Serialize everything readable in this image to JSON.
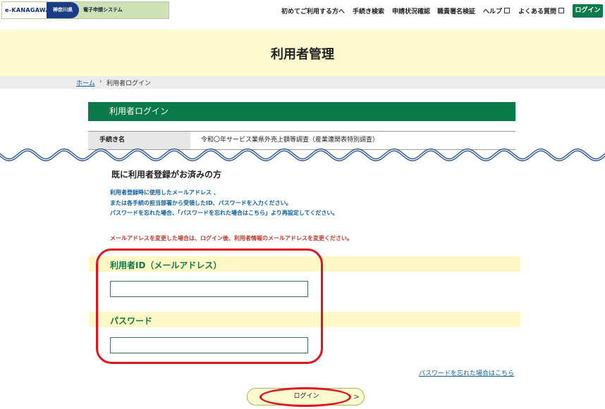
{
  "header": {
    "logo": {
      "brand": "e-KANAGAWA",
      "prefecture": "神奈川県",
      "system": "電子申請システム"
    },
    "nav": [
      {
        "label": "初めてご利用する方へ",
        "external": false
      },
      {
        "label": "手続き検索",
        "external": false
      },
      {
        "label": "申請状況確認",
        "external": false
      },
      {
        "label": "職責署名検証",
        "external": false
      },
      {
        "label": "ヘルプ",
        "external": true
      },
      {
        "label": "よくある質問",
        "external": true
      }
    ],
    "login_label": "ログイン"
  },
  "page_title": "利用者管理",
  "breadcrumb": {
    "home": "ホーム",
    "separator": "›",
    "current": "利用者ログイン"
  },
  "section_heading": "利用者ログイン",
  "procedure": {
    "label": "手続き名",
    "value": "令和〇年サービス業県外売上額等調査（産業連関表特別調査）"
  },
  "login_section": {
    "heading": "既に利用者登録がお済みの方",
    "info_lines": [
      "利用者登録時に使用したメールアドレス 、",
      "または各手続の担当部署から受領したID、パスワードを入力ください。",
      "パスワードを忘れた場合、「パスワードを忘れた場合はこちら」より再設定してください。"
    ],
    "warning": "メールアドレスを変更した場合は、ログイン後、利用者情報のメールアドレスを変更ください。",
    "user_id_label": "利用者ID（メールアドレス）",
    "user_id_value": "",
    "password_label": "パスワード",
    "password_value": "",
    "forgot_link": "パスワードを忘れた場合はこちら",
    "login_button": "ログイン",
    "login_arrow": ">"
  },
  "colors": {
    "green": "#0b7a4a",
    "banner_yellow": "#fefbd0",
    "link_blue": "#0c5d9e",
    "warning_red": "#c0392b",
    "highlight_red": "#e0141e"
  }
}
